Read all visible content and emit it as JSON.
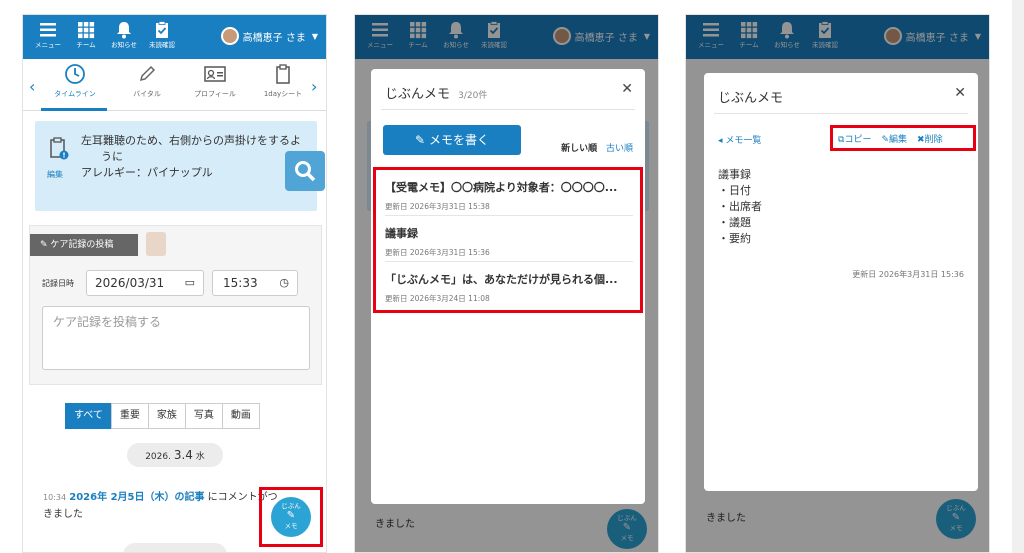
{
  "header": {
    "menu_label": "メニュー",
    "team_label": "チーム",
    "notice_label": "お知らせ",
    "unread_label": "未読確認",
    "user_name": "高橋恵子 さま"
  },
  "tabs": [
    {
      "label": "タイムライン"
    },
    {
      "label": "バイタル"
    },
    {
      "label": "プロフィール"
    },
    {
      "label": "1dayシート"
    }
  ],
  "notice": {
    "text": "左耳難聴のため、右側からの声掛けをするようにアレルギー：パイナップル",
    "line1": "左耳難聴のため、右側からの声掛けをするよ",
    "line2": "うに",
    "line3": "アレルギー：パイナップル",
    "edit_label": "編集"
  },
  "care": {
    "post_button": "ケア記録の投稿",
    "datetime_label": "記録日時",
    "date_value": "2026/03/31",
    "time_value": "15:33",
    "placeholder": "ケア記録を投稿する"
  },
  "filters": [
    "すべて",
    "重要",
    "家族",
    "写真",
    "動画"
  ],
  "timeline": {
    "date_prefix": "2026.",
    "date_day": "3.4",
    "date_weekday": "水",
    "post_time": "10:34",
    "post_link": "2026年 2月5日（木）の記事",
    "post_text1": "にコメントがつ",
    "post_text2": "きました"
  },
  "fab": {
    "line1": "じぶん",
    "line2": "メモ"
  },
  "memo_list": {
    "title": "じぶんメモ",
    "count": "3/20件",
    "write_button": "メモを書く",
    "sort_new": "新しい順",
    "sort_old": "古い順",
    "items": [
      {
        "title": "【受電メモ】〇〇病院より対象者：〇〇〇〇...",
        "date": "更新日 2026年3月31日 15:38"
      },
      {
        "title": "議事録",
        "date": "更新日 2026年3月31日 15:36"
      },
      {
        "title": "「じぶんメモ」は、あなただけが見られる個...",
        "date": "更新日 2026年3月24日 11:08"
      }
    ]
  },
  "memo_detail": {
    "title": "じぶんメモ",
    "back_label": "メモ一覧",
    "copy_label": "コピー",
    "edit_label": "編集",
    "delete_label": "削除",
    "body": [
      "議事録",
      "・日付",
      "・出席者",
      "・議題",
      "・要約"
    ],
    "updated": "更新日 2026年3月31日 15:36"
  },
  "colors": {
    "primary": "#1a7fc1",
    "highlight": "#e60012",
    "notice_bg": "#d6ecf8"
  }
}
